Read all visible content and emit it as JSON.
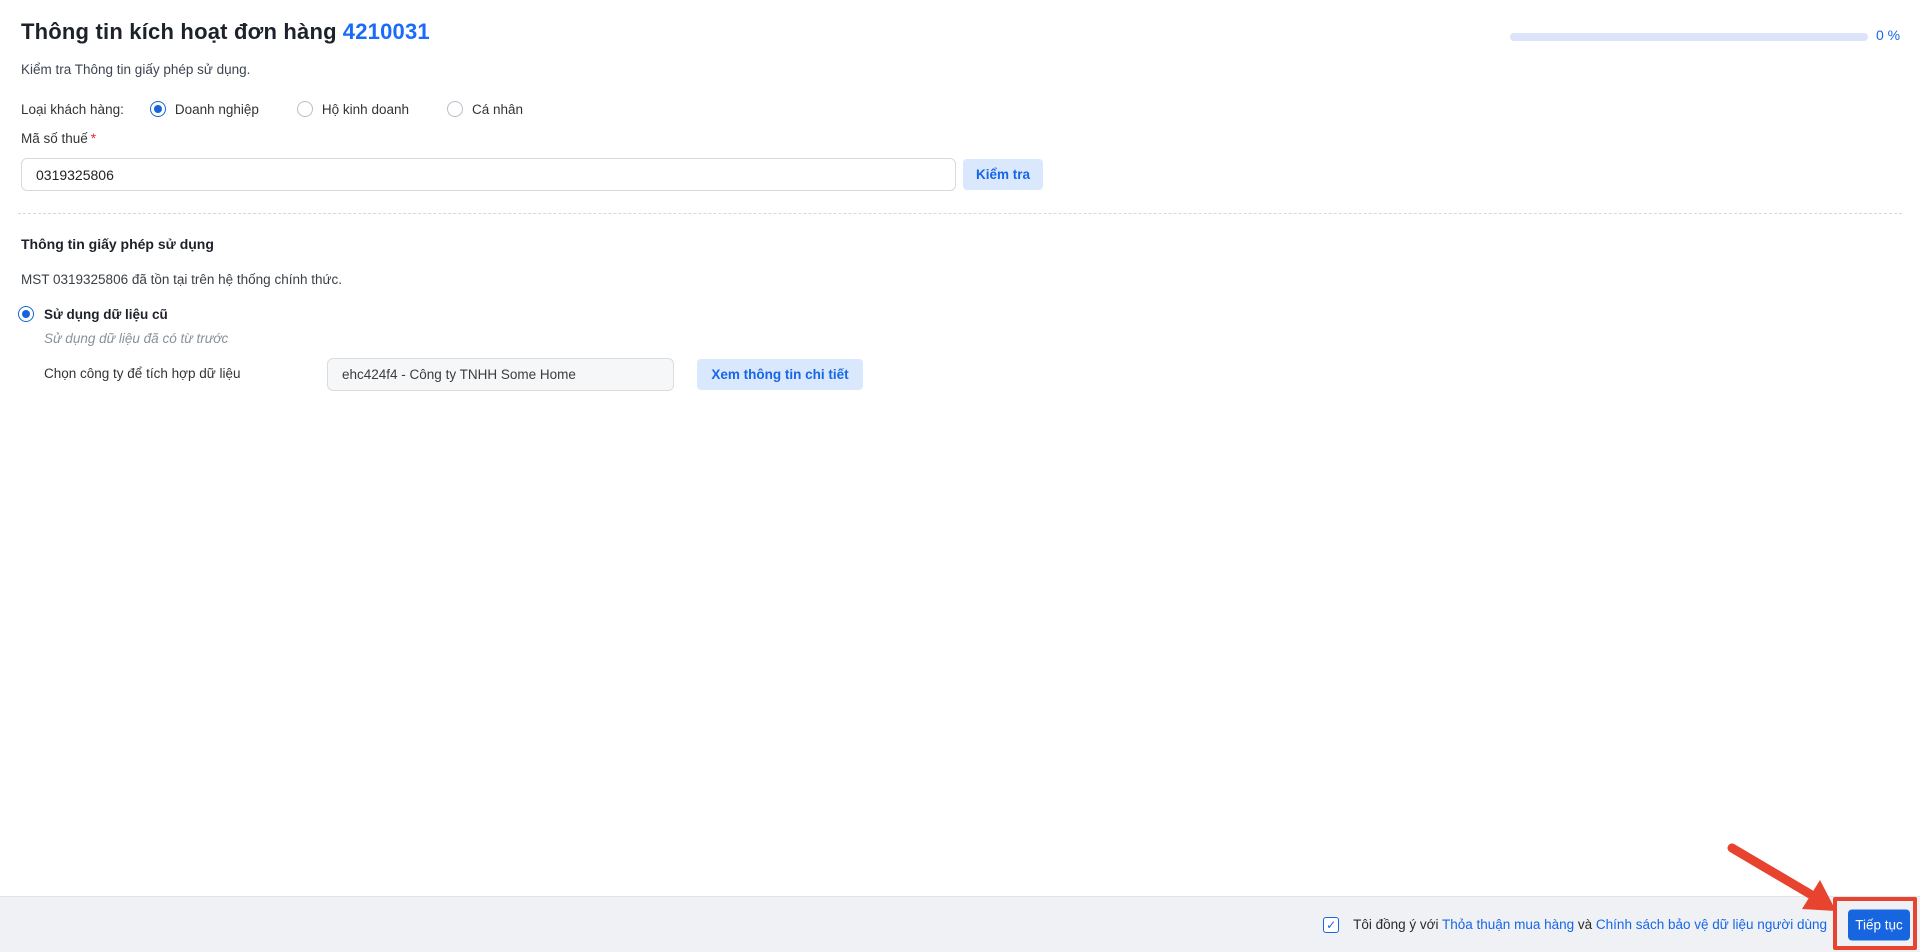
{
  "page": {
    "title": "Thông tin kích hoạt đơn hàng",
    "order_number": "4210031",
    "subtitle": "Kiểm tra Thông tin giấy phép sử dụng.",
    "progress": {
      "value": 0,
      "percent_label": "0 %"
    }
  },
  "form": {
    "customer_type": {
      "label": "Loại khách hàng:",
      "options": [
        {
          "label": "Doanh nghiệp",
          "selected": true
        },
        {
          "label": "Hộ kinh doanh",
          "selected": false
        },
        {
          "label": "Cá nhân",
          "selected": false
        }
      ]
    },
    "tax_code": {
      "label": "Mã số thuế",
      "required_mark": "*",
      "value": "0319325806",
      "check_button_label": "Kiểm tra"
    },
    "license_section": {
      "heading": "Thông tin giấy phép sử dụng",
      "status_text": "MST 0319325806 đã tồn tại trên hệ thống chính thức.",
      "use_old_data": {
        "label": "Sử dụng dữ liệu cũ",
        "selected": true,
        "description": "Sử dụng dữ liệu đã có từ trước"
      },
      "company_select": {
        "label": "Chọn công ty để tích hợp dữ liệu",
        "value": "ehc424f4 - Công ty TNHH Some Home",
        "detail_button_label": "Xem thông tin chi tiết"
      }
    }
  },
  "footer": {
    "agree_checkbox_checked": true,
    "agree_prefix": "Tôi đồng ý với",
    "terms_link": "Thỏa thuận mua hàng",
    "agree_middle": "và",
    "privacy_link": "Chính sách bảo vệ dữ liệu người dùng",
    "continue_button_label": "Tiếp tục"
  },
  "icons": {
    "check": "✓"
  },
  "colors": {
    "accent_blue": "#1766e8",
    "order_number_blue": "#1a6bfa",
    "light_button_bg": "#d9e8fc",
    "progress_track": "#dbe4f8",
    "footer_bg": "#f0f1f4",
    "annotation_red": "#e8432f",
    "required_red": "#f5222d"
  }
}
